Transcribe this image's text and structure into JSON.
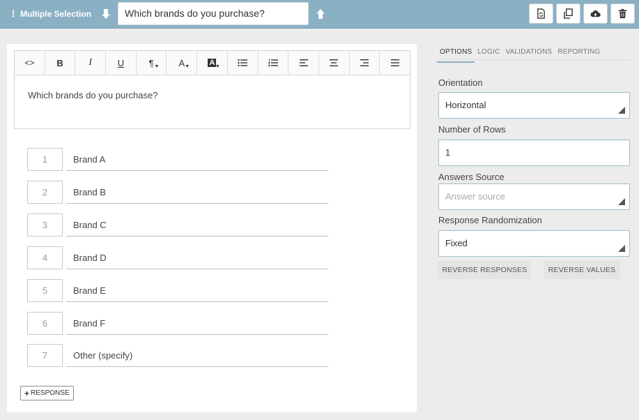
{
  "topbar": {
    "question_type": "Multiple Selection",
    "question_text": "Which brands do you purchase?"
  },
  "editor": {
    "toolbar_buttons": [
      {
        "name": "code",
        "glyph": "<>"
      },
      {
        "name": "bold",
        "glyph": "B"
      },
      {
        "name": "italic",
        "glyph": "I"
      },
      {
        "name": "underline",
        "glyph": "U"
      },
      {
        "name": "paragraph",
        "glyph": "¶"
      },
      {
        "name": "font-color",
        "glyph": "A"
      },
      {
        "name": "highlight-color",
        "glyph": "A"
      },
      {
        "name": "bullet-list",
        "glyph": ""
      },
      {
        "name": "numbered-list",
        "glyph": ""
      },
      {
        "name": "align-left",
        "glyph": ""
      },
      {
        "name": "align-center",
        "glyph": ""
      },
      {
        "name": "align-right",
        "glyph": ""
      },
      {
        "name": "justify",
        "glyph": ""
      }
    ],
    "content": "Which brands do you purchase?"
  },
  "responses": [
    {
      "num": "1",
      "label": "Brand A"
    },
    {
      "num": "2",
      "label": "Brand B"
    },
    {
      "num": "3",
      "label": "Brand C"
    },
    {
      "num": "4",
      "label": "Brand D"
    },
    {
      "num": "5",
      "label": "Brand E"
    },
    {
      "num": "6",
      "label": "Brand F"
    },
    {
      "num": "7",
      "label": "Other (specify)"
    }
  ],
  "add_response_label": "RESPONSE",
  "settings": {
    "tabs": [
      "OPTIONS",
      "LOGIC",
      "VALIDATIONS",
      "REPORTING"
    ],
    "active_tab": "OPTIONS",
    "orientation_label": "Orientation",
    "orientation_value": "Horizontal",
    "rows_label": "Number of Rows",
    "rows_value": "1",
    "answers_source_label": "Answers Source",
    "answers_source_placeholder": "Answer source",
    "randomization_label": "Response Randomization",
    "randomization_value": "Fixed",
    "reverse_responses_label": "REVERSE RESPONSES",
    "reverse_values_label": "REVERSE VALUES"
  },
  "colors": {
    "topbar": "#8ab0c4",
    "field_border": "#9fbdcc"
  },
  "icons": {
    "toolbar_right": [
      "refresh-doc-icon",
      "copy-icon",
      "cloud-upload-icon",
      "trash-icon"
    ]
  }
}
